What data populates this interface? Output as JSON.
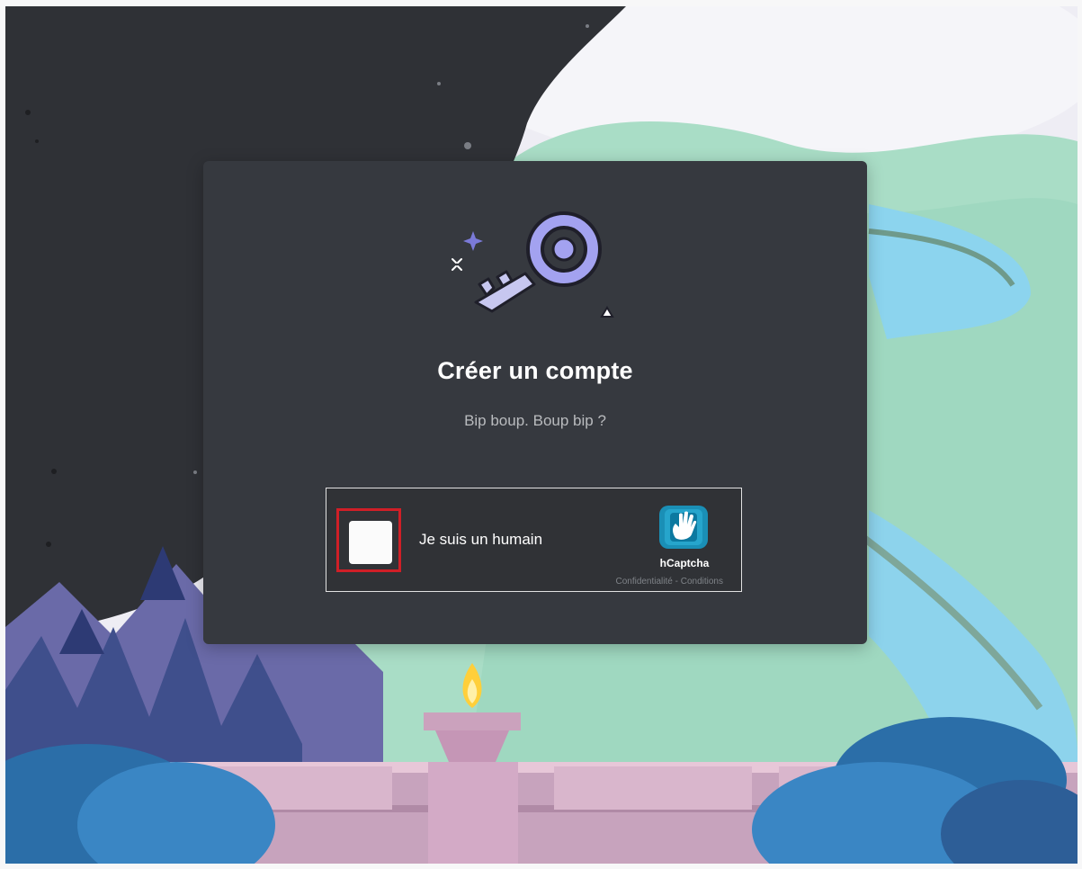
{
  "modal": {
    "title": "Créer un compte",
    "subtitle": "Bip boup. Boup bip ?"
  },
  "captcha": {
    "checkbox_label": "Je suis un humain",
    "brand": "hCaptcha",
    "privacy_link": "Confidentialité",
    "separator": " - ",
    "terms_link": "Conditions"
  },
  "colors": {
    "modal_background": "#36393f",
    "title": "#ffffff",
    "subtitle": "#b9bbbe",
    "checkbox_highlight": "#d01f27"
  },
  "icons": {
    "hero": "key-icon",
    "captcha": "hcaptcha-hand-logo"
  }
}
